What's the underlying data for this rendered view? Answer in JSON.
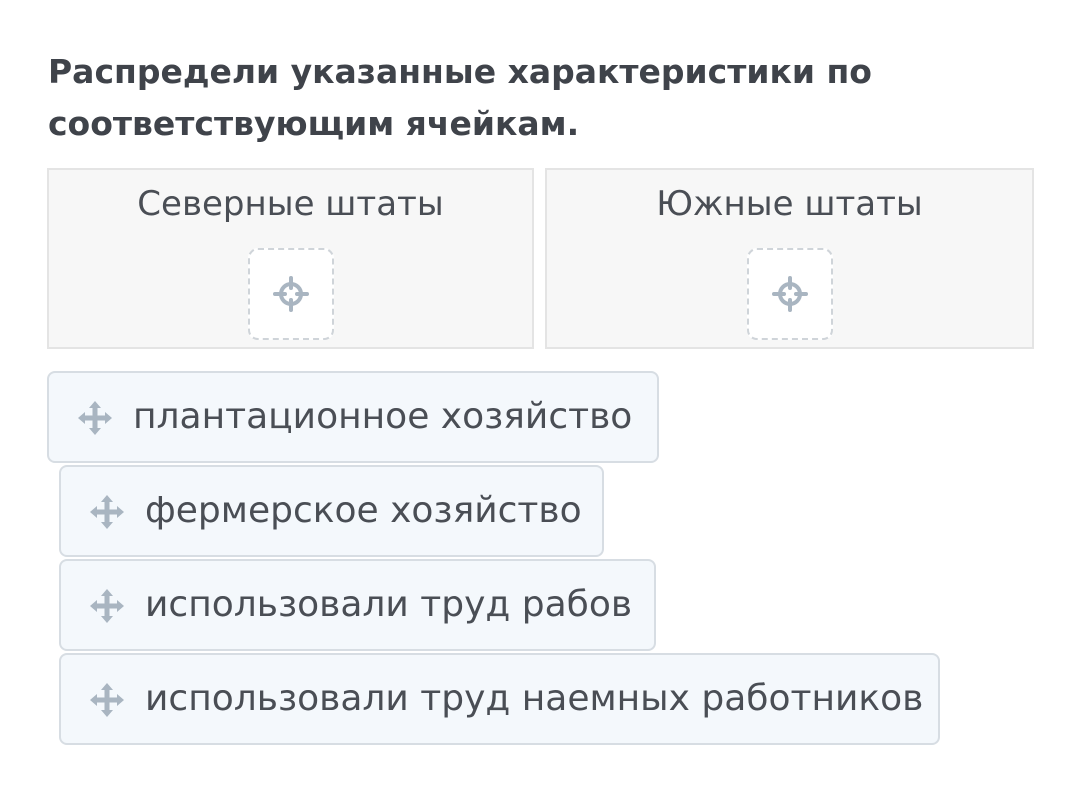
{
  "question": "Распредели указанные характеристики по соответствующим ячейкам.",
  "dropzones": [
    {
      "title": "Северные штаты",
      "slot_icon": "target-crosshair-icon"
    },
    {
      "title": "Южные штаты",
      "slot_icon": "target-crosshair-icon"
    }
  ],
  "cards": [
    {
      "label": "плантационное хозяйство",
      "icon": "move-arrows-icon"
    },
    {
      "label": "фермерское хозяйство",
      "icon": "move-arrows-icon"
    },
    {
      "label": "использовали труд рабов",
      "icon": "move-arrows-icon"
    },
    {
      "label": "использовали труд наемных работников",
      "icon": "move-arrows-icon"
    }
  ],
  "colors": {
    "text": "#3f434a",
    "icon": "#a9b5c1",
    "zone_bg": "#f7f7f7",
    "card_bg": "#f4f8fc",
    "card_border": "#d7dde3"
  }
}
